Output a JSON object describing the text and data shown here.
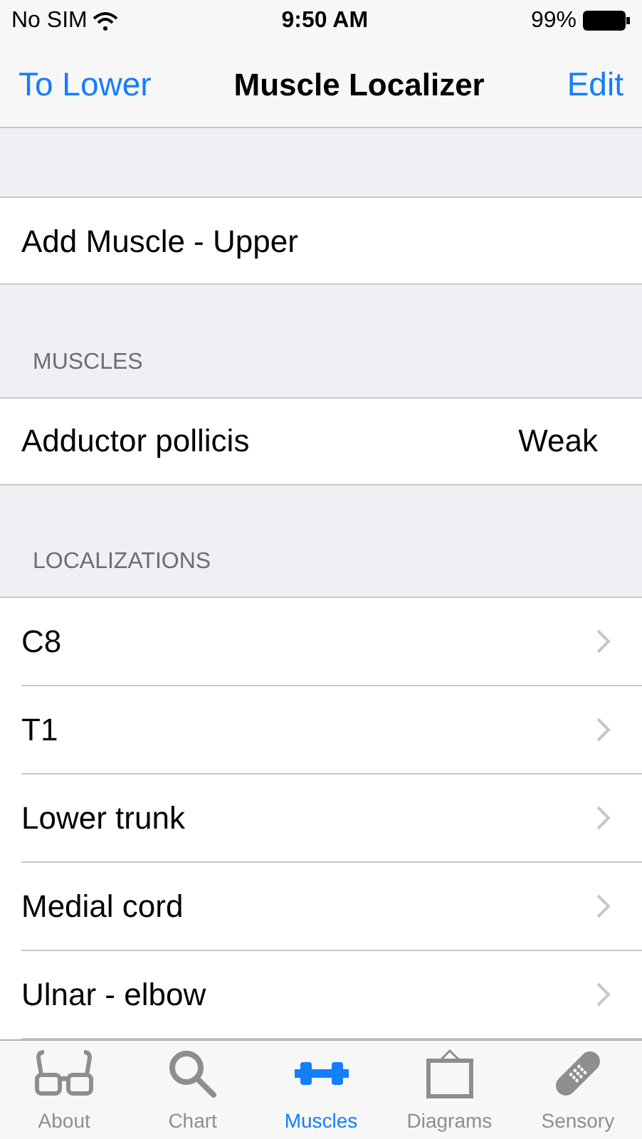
{
  "status_bar": {
    "carrier": "No SIM",
    "time": "9:50 AM",
    "battery": "99%"
  },
  "nav": {
    "back": "To Lower",
    "title": "Muscle Localizer",
    "action": "Edit"
  },
  "add_row": {
    "label": "Add Muscle - Upper"
  },
  "muscles": {
    "header": "MUSCLES",
    "rows": [
      {
        "name": "Adductor pollicis",
        "value": "Weak"
      }
    ]
  },
  "localizations": {
    "header": "LOCALIZATIONS",
    "rows": [
      {
        "label": "C8"
      },
      {
        "label": "T1"
      },
      {
        "label": "Lower trunk"
      },
      {
        "label": "Medial cord"
      },
      {
        "label": "Ulnar - elbow"
      }
    ]
  },
  "tabs": [
    {
      "label": "About",
      "kind": "glasses",
      "selected": false
    },
    {
      "label": "Chart",
      "kind": "search",
      "selected": false
    },
    {
      "label": "Muscles",
      "kind": "dumbbell",
      "selected": true
    },
    {
      "label": "Diagrams",
      "kind": "frame",
      "selected": false
    },
    {
      "label": "Sensory",
      "kind": "bandage",
      "selected": false
    }
  ]
}
